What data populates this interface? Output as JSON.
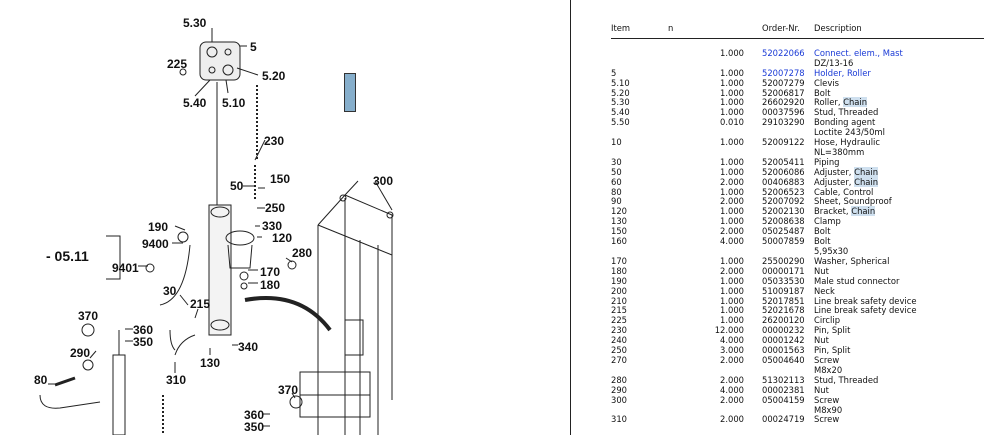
{
  "diagram": {
    "callouts": [
      {
        "text": "5.30"
      },
      {
        "text": "5"
      },
      {
        "text": "225"
      },
      {
        "text": "5.20"
      },
      {
        "text": "5.40"
      },
      {
        "text": "5.10"
      },
      {
        "text": "230"
      },
      {
        "text": "50"
      },
      {
        "text": "150"
      },
      {
        "text": "300"
      },
      {
        "text": "250"
      },
      {
        "text": "190"
      },
      {
        "text": "330"
      },
      {
        "text": "120"
      },
      {
        "text": "9400"
      },
      {
        "text": "280"
      },
      {
        "text": "- 05.11"
      },
      {
        "text": "9401"
      },
      {
        "text": "170"
      },
      {
        "text": "180"
      },
      {
        "text": "30"
      },
      {
        "text": "215"
      },
      {
        "text": "370"
      },
      {
        "text": "360"
      },
      {
        "text": "350"
      },
      {
        "text": "340"
      },
      {
        "text": "290"
      },
      {
        "text": "130"
      },
      {
        "text": "80"
      },
      {
        "text": "310"
      },
      {
        "text": "370"
      },
      {
        "text": "360"
      },
      {
        "text": "350"
      }
    ]
  },
  "table": {
    "headers": {
      "item": "Item",
      "n": "n",
      "order": "Order-Nr.",
      "desc": "Description"
    },
    "rows": [
      {
        "item": "",
        "n": "1.000",
        "order": "52022066",
        "desc": "Connect. elem., Mast",
        "link": true
      },
      {
        "item": "",
        "n": "",
        "order": "",
        "desc": "DZ/13-16"
      },
      {
        "item": "5",
        "n": "1.000",
        "order": "52007278",
        "desc": "Holder, Roller",
        "link": true
      },
      {
        "item": "5.10",
        "n": "1.000",
        "order": "52007279",
        "desc": "Clevis"
      },
      {
        "item": "5.20",
        "n": "1.000",
        "order": "52006817",
        "desc": "Bolt"
      },
      {
        "item": "5.30",
        "n": "1.000",
        "order": "26602920",
        "desc": "Roller, ",
        "hl": "Chain"
      },
      {
        "item": "5.40",
        "n": "1.000",
        "order": "00037596",
        "desc": "Stud, Threaded"
      },
      {
        "item": "5.50",
        "n": "0.010",
        "order": "29103290",
        "desc": "Bonding agent"
      },
      {
        "item": "",
        "n": "",
        "order": "",
        "desc": "Loctite 243/50ml"
      },
      {
        "item": "10",
        "n": "1.000",
        "order": "52009122",
        "desc": "Hose, Hydraulic"
      },
      {
        "item": "",
        "n": "",
        "order": "",
        "desc": "NL=380mm"
      },
      {
        "item": "30",
        "n": "1.000",
        "order": "52005411",
        "desc": "Piping"
      },
      {
        "item": "50",
        "n": "1.000",
        "order": "52006086",
        "desc": "Adjuster, ",
        "hl": "Chain"
      },
      {
        "item": "60",
        "n": "2.000",
        "order": "00406883",
        "desc": "Adjuster, ",
        "hl": "Chain"
      },
      {
        "item": "80",
        "n": "1.000",
        "order": "52006523",
        "desc": "Cable, Control"
      },
      {
        "item": "90",
        "n": "2.000",
        "order": "52007092",
        "desc": "Sheet, Soundproof"
      },
      {
        "item": "120",
        "n": "1.000",
        "order": "52002130",
        "desc": "Bracket, ",
        "hl": "Chain"
      },
      {
        "item": "130",
        "n": "1.000",
        "order": "52008638",
        "desc": "Clamp"
      },
      {
        "item": "150",
        "n": "2.000",
        "order": "05025487",
        "desc": "Bolt"
      },
      {
        "item": "160",
        "n": "4.000",
        "order": "50007859",
        "desc": "Bolt"
      },
      {
        "item": "",
        "n": "",
        "order": "",
        "desc": "5,95x30"
      },
      {
        "item": "170",
        "n": "1.000",
        "order": "25500290",
        "desc": "Washer, Spherical"
      },
      {
        "item": "180",
        "n": "2.000",
        "order": "00000171",
        "desc": "Nut"
      },
      {
        "item": "190",
        "n": "1.000",
        "order": "05033530",
        "desc": "Male stud connector"
      },
      {
        "item": "200",
        "n": "1.000",
        "order": "51009187",
        "desc": "Neck"
      },
      {
        "item": "210",
        "n": "1.000",
        "order": "52017851",
        "desc": "Line break safety device"
      },
      {
        "item": "215",
        "n": "1.000",
        "order": "52021678",
        "desc": "Line break safety device"
      },
      {
        "item": "225",
        "n": "1.000",
        "order": "26200120",
        "desc": "Circlip"
      },
      {
        "item": "230",
        "n": "12.000",
        "order": "00000232",
        "desc": "Pin, Split"
      },
      {
        "item": "240",
        "n": "4.000",
        "order": "00001242",
        "desc": "Nut"
      },
      {
        "item": "250",
        "n": "3.000",
        "order": "00001563",
        "desc": "Pin, Split"
      },
      {
        "item": "270",
        "n": "2.000",
        "order": "05004640",
        "desc": "Screw"
      },
      {
        "item": "",
        "n": "",
        "order": "",
        "desc": "M8x20"
      },
      {
        "item": "280",
        "n": "2.000",
        "order": "51302113",
        "desc": "Stud, Threaded"
      },
      {
        "item": "290",
        "n": "4.000",
        "order": "00002381",
        "desc": "Nut"
      },
      {
        "item": "300",
        "n": "2.000",
        "order": "05004159",
        "desc": "Screw"
      },
      {
        "item": "",
        "n": "",
        "order": "",
        "desc": "M8x90"
      },
      {
        "item": "310",
        "n": "2.000",
        "order": "00024719",
        "desc": "Screw"
      }
    ]
  },
  "colors": {
    "link": "#1a3ad6",
    "highlight": "#cfe0ef",
    "marker": "#86aecb"
  }
}
